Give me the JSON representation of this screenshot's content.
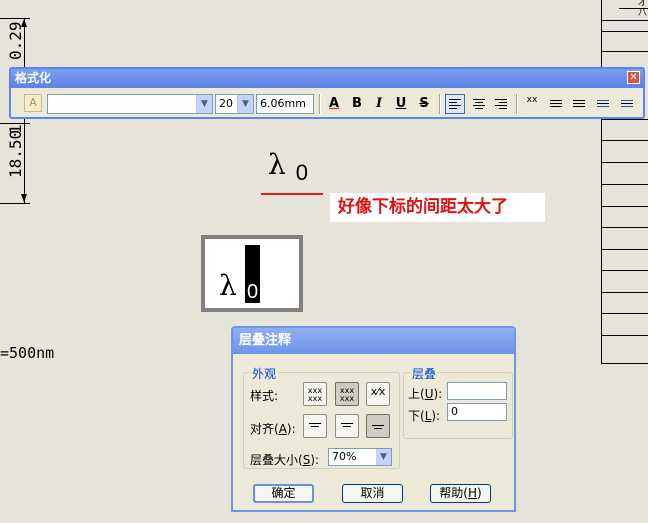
{
  "drawing": {
    "dim_top": "0.29",
    "dim_bottom": "18.50",
    "dim_cut": "1",
    "corner_text": "才",
    "corner_text2": "八",
    "lambda_symbol": "λ",
    "lambda_sub": "0",
    "annotation_note": "好像下标的间距太大了",
    "preview_symbol": "λ",
    "preview_sub": "0",
    "left_text": "=500nm"
  },
  "toolbar": {
    "title": "格式化",
    "close_glyph": "✕",
    "font_icon": "A",
    "font_name": "",
    "font_size": "20",
    "height_value": "6.06mm",
    "color_label": "A",
    "bold_label": "B",
    "italic_label": "I",
    "underline_label": "U",
    "strike_label": "S",
    "stack_label": "xx",
    "dropdown_glyph": "▼"
  },
  "dialog": {
    "title": "层叠注释",
    "appearance_group": "外观",
    "style_label": "样式:",
    "align_label": "对齐(A):",
    "size_label": "层叠大小(S):",
    "size_value": "70%",
    "stack_group": "层叠",
    "upper_label": "上(U):",
    "upper_value": "",
    "lower_label": "下(L):",
    "lower_value": "0",
    "ok_label": "确定",
    "cancel_label": "取消",
    "help_label": "帮助(H)",
    "style_icon1": "xxx xxx",
    "style_icon2": "xxx xxx",
    "style_icon3": "x⁄x"
  },
  "colors": {
    "accent": "#5f83e8",
    "note_red": "#e01010",
    "background": "#e6e3d8"
  }
}
